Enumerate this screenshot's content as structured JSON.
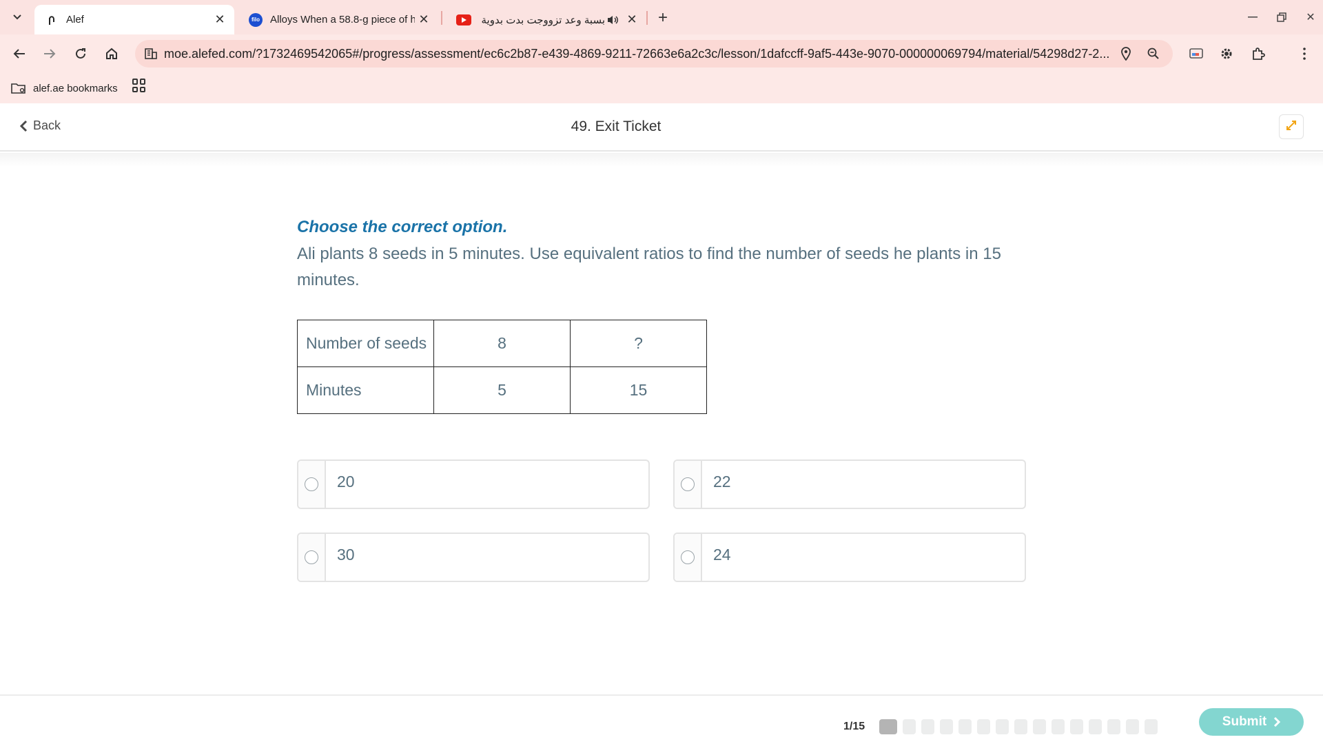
{
  "browser": {
    "tabs": [
      {
        "title": "Alef",
        "active": true
      },
      {
        "title": "Alloys When a 58.8-g piece of h",
        "favicon": "filo-icon"
      },
      {
        "title": "بسبة وعد تزووجت بدت بدوية",
        "favicon": "youtube-icon"
      }
    ],
    "url": "moe.alefed.com/?1732469542065#/progress/assessment/ec6c2b87-e439-4869-9211-72663e6a2c3c/lesson/1dafccff-9af5-443e-9070-000000069794/material/54298d27-2...",
    "bookmark_label": "alef.ae bookmarks"
  },
  "header": {
    "back_label": "Back",
    "title": "49. Exit Ticket"
  },
  "question": {
    "instruction": "Choose the correct option.",
    "text": "Ali plants 8 seeds in 5 minutes. Use equivalent ratios to find the number of seeds he plants in 15 minutes.",
    "table": [
      [
        "Number of seeds",
        "8",
        "?"
      ],
      [
        "Minutes",
        "5",
        "15"
      ]
    ],
    "options": [
      "20",
      "22",
      "30",
      "24"
    ]
  },
  "footer": {
    "counter": "1/15",
    "total_steps": 15,
    "current_step": 1,
    "submit_label": "Submit"
  },
  "colors": {
    "accent": "#1a73a8",
    "submit": "#83d6d0",
    "expand_icon": "#f2a516"
  }
}
